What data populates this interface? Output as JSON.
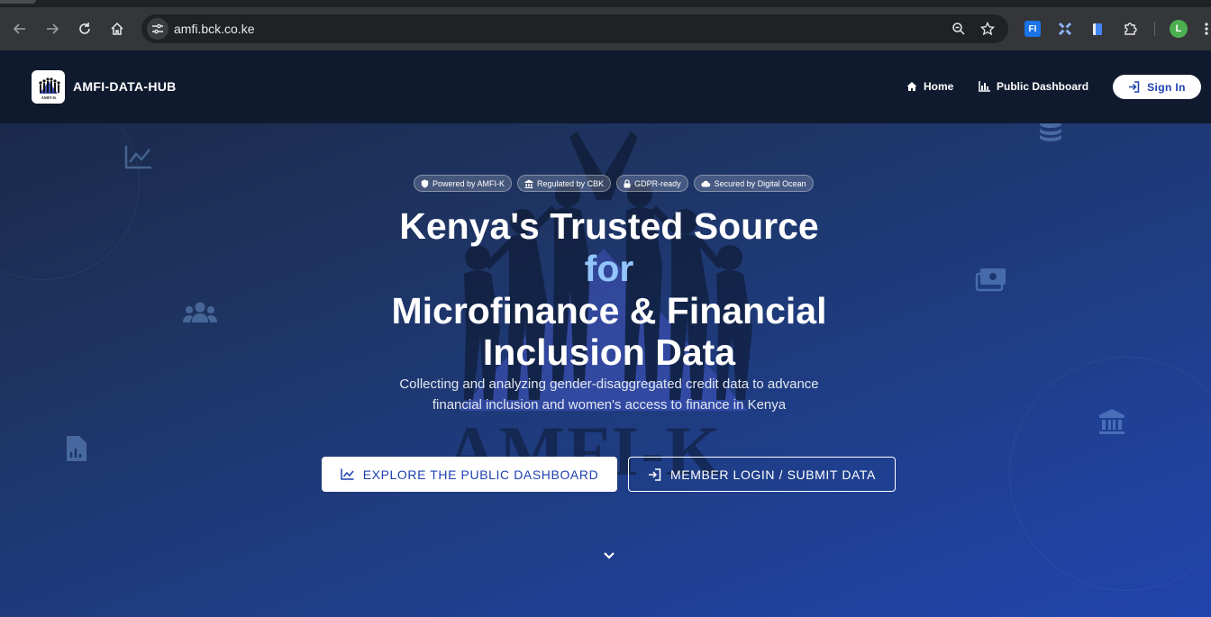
{
  "browser": {
    "url": "amfi.bck.co.ke",
    "profile_initial": "L",
    "icons": {
      "back": "arrow-left-icon",
      "forward": "arrow-right-icon",
      "reload": "reload-icon",
      "home": "home-icon",
      "site_info": "tune-icon",
      "zoom": "zoom-icon",
      "bookmark": "star-icon",
      "extensions": "puzzle-icon",
      "menu": "kebab-menu-icon"
    },
    "extension_fi_label": "FI"
  },
  "navbar": {
    "brand": "AMFI-DATA-HUB",
    "logo_text": "AMFI-K",
    "links": [
      {
        "label": "Home",
        "icon": "home-icon"
      },
      {
        "label": "Public Dashboard",
        "icon": "bar-chart-icon"
      }
    ],
    "signin_label": "Sign In"
  },
  "hero": {
    "badges": [
      {
        "label": "Powered by AMFI-K",
        "icon": "shield-icon"
      },
      {
        "label": "Regulated by CBK",
        "icon": "bank-icon"
      },
      {
        "label": "GDPR-ready",
        "icon": "lock-icon"
      },
      {
        "label": "Secured by Digital Ocean",
        "icon": "cloud-icon"
      }
    ],
    "title_line1": "Kenya's Trusted Source",
    "title_line2": "for",
    "title_line3": "Microfinance & Financial",
    "title_line4": "Inclusion Data",
    "subtitle_line1": "Collecting and analyzing gender-disaggregated credit data to advance",
    "subtitle_line2": "financial inclusion and women's access to finance in Kenya",
    "primary_button": "EXPLORE THE PUBLIC DASHBOARD",
    "secondary_button": "MEMBER LOGIN / SUBMIT DATA",
    "watermark": "AMFI-K"
  },
  "colors": {
    "navbar_bg": "#0f1a2e",
    "accent_blue": "#1e40af",
    "title_accent": "#93c5fd"
  }
}
